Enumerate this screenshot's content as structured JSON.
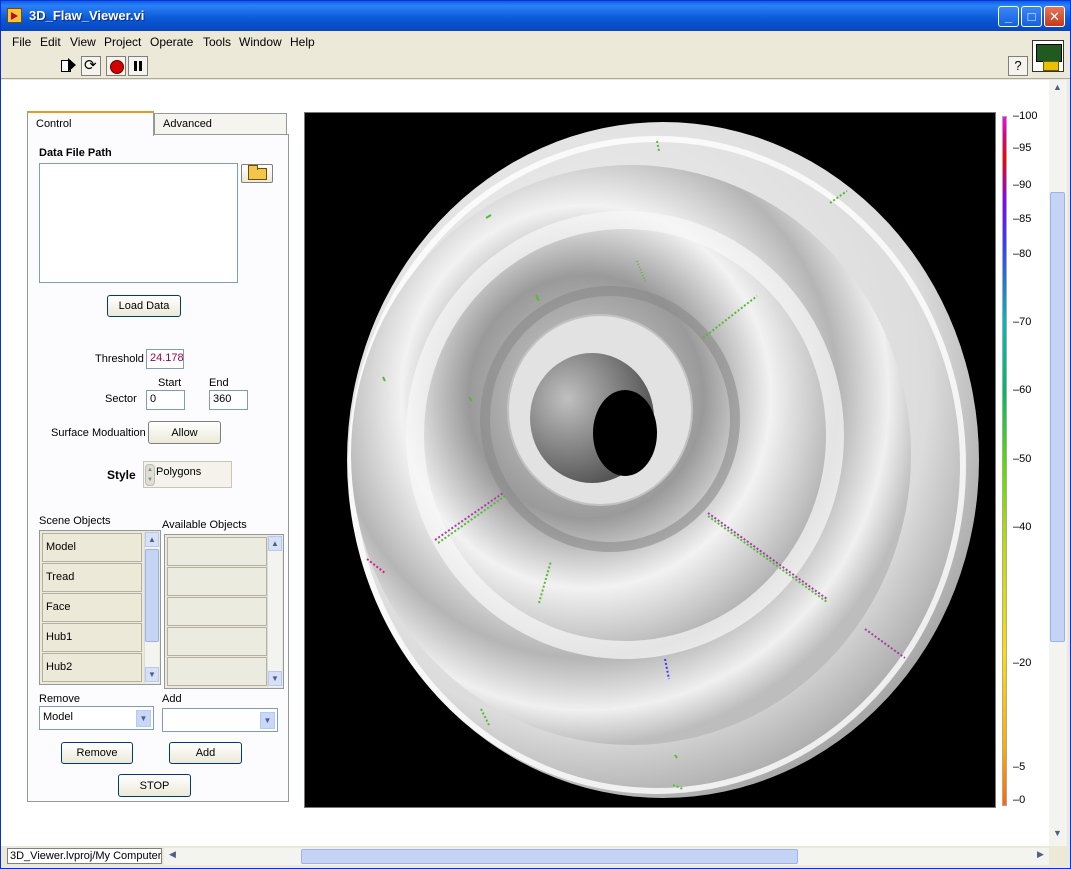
{
  "window": {
    "title": "3D_Flaw_Viewer.vi",
    "minimize": "_",
    "maximize": "□",
    "close": "✕"
  },
  "menu": [
    {
      "label": "File"
    },
    {
      "label": "Edit"
    },
    {
      "label": "View"
    },
    {
      "label": "Project"
    },
    {
      "label": "Operate"
    },
    {
      "label": "Tools"
    },
    {
      "label": "Window"
    },
    {
      "label": "Help"
    }
  ],
  "toolbar": {
    "help": "?"
  },
  "tabs": {
    "control": "Control",
    "advanced": "Advanced"
  },
  "control": {
    "data_file_path_label": "Data File Path",
    "data_file_path_value": "",
    "load_data": "Load Data",
    "threshold_label": "Threshold",
    "threshold_value": "24.178",
    "sector_label": "Sector",
    "start_label": "Start",
    "end_label": "End",
    "start_value": "0",
    "end_value": "360",
    "surface_label": "Surface Modualtion",
    "surface_button": "Allow",
    "style_label": "Style",
    "style_value": "Polygons",
    "scene_objects_label": "Scene Objects",
    "available_objects_label": "Available Objects",
    "scene_objects": [
      "Model",
      "Tread",
      "Face",
      "Hub1",
      "Hub2"
    ],
    "remove_label": "Remove",
    "add_label": "Add",
    "remove_selected": "Model",
    "add_selected": "",
    "remove_button": "Remove",
    "add_button": "Add",
    "stop_button": "STOP"
  },
  "scale": {
    "ticks": [
      "100",
      "95",
      "90",
      "85",
      "80",
      "70",
      "60",
      "50",
      "40",
      "20",
      "5",
      "0"
    ],
    "tick_values": [
      100,
      95,
      90,
      85,
      80,
      70,
      60,
      50,
      40,
      20,
      5,
      0
    ],
    "colors": [
      "#ff00ff",
      "#ff0000",
      "#3a3aff",
      "#00bbbb",
      "#55dd00",
      "#ffdd00",
      "#ff6600"
    ]
  },
  "status": {
    "path": "3D_Viewer.lvproj/My Computer"
  }
}
